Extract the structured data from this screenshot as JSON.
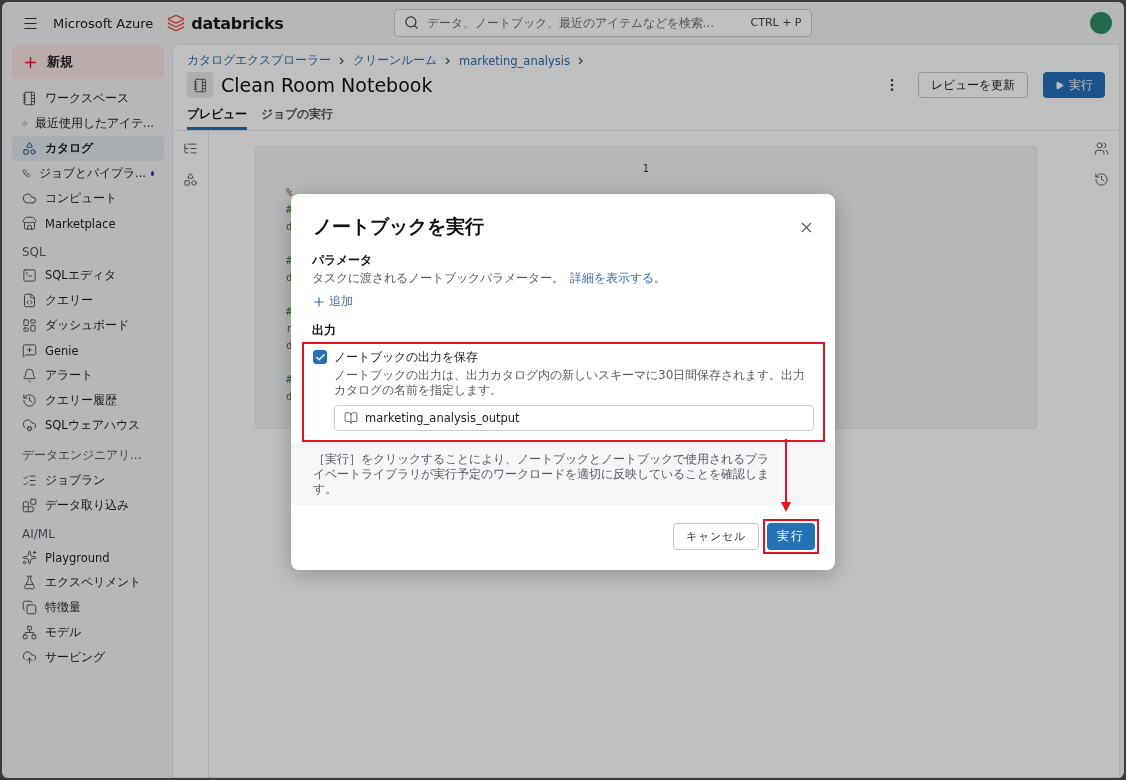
{
  "topbar": {
    "brand": "Microsoft Azure",
    "product": "databricks",
    "search": {
      "placeholder": "データ、ノートブック、最近のアイテムなどを検索...",
      "shortcut": "CTRL + P"
    }
  },
  "sidebar": {
    "new_button": "新規",
    "sections": [
      {
        "items": [
          {
            "label": "ワークスペース",
            "selected": false,
            "dot": false
          },
          {
            "label": "最近使用したアイテ...",
            "selected": false,
            "dot": false
          },
          {
            "label": "カタログ",
            "selected": true,
            "dot": false
          },
          {
            "label": "ジョブとパイプラ...",
            "selected": false,
            "dot": true
          },
          {
            "label": "コンピュート",
            "selected": false,
            "dot": false
          },
          {
            "label": "Marketplace",
            "selected": false,
            "dot": false
          }
        ]
      },
      {
        "heading": "SQL",
        "items": [
          {
            "label": "SQLエディタ",
            "selected": false,
            "dot": false
          },
          {
            "label": "クエリー",
            "selected": false,
            "dot": false
          },
          {
            "label": "ダッシュボード",
            "selected": false,
            "dot": false
          },
          {
            "label": "Genie",
            "selected": false,
            "dot": false
          },
          {
            "label": "アラート",
            "selected": false,
            "dot": false
          },
          {
            "label": "クエリー履歴",
            "selected": false,
            "dot": false
          },
          {
            "label": "SQLウェアハウス",
            "selected": false,
            "dot": false
          }
        ]
      },
      {
        "heading": "データエンジニアリ...",
        "items": [
          {
            "label": "ジョブラン",
            "selected": false,
            "dot": false
          },
          {
            "label": "データ取り込み",
            "selected": false,
            "dot": false
          }
        ]
      },
      {
        "heading": "AI/ML",
        "items": [
          {
            "label": "Playground",
            "selected": false,
            "dot": false
          },
          {
            "label": "エクスペリメント",
            "selected": false,
            "dot": false
          },
          {
            "label": "特徴量",
            "selected": false,
            "dot": false
          },
          {
            "label": "モデル",
            "selected": false,
            "dot": false
          },
          {
            "label": "サービング",
            "selected": false,
            "dot": false
          }
        ]
      }
    ]
  },
  "page": {
    "breadcrumb": [
      "カタログエクスプローラー",
      "クリーンルーム",
      "marketing_analysis"
    ],
    "title": "Clean Room Notebook",
    "review_button": "レビューを更新",
    "run_button": "実行",
    "tabs": [
      {
        "label": "プレビュー",
        "selected": true
      },
      {
        "label": "ジョブの実行",
        "selected": false
      }
    ],
    "notebook": {
      "cell_number": "1",
      "lines": [
        {
          "text": "%",
          "kind": "code"
        },
        {
          "text": "#",
          "kind": "comment"
        },
        {
          "text": "d",
          "kind": "code"
        },
        {
          "kind": "blank"
        },
        {
          "text": "#",
          "kind": "comment"
        },
        {
          "text": "d",
          "kind": "code"
        },
        {
          "kind": "blank"
        },
        {
          "text": "#",
          "kind": "comment"
        },
        {
          "text": "r",
          "kind": "code"
        },
        {
          "text": "d",
          "kind": "code"
        },
        {
          "kind": "blank"
        },
        {
          "text": "#",
          "kind": "comment"
        },
        {
          "text": "d",
          "kind": "code"
        }
      ]
    }
  },
  "dialog": {
    "title": "ノートブックを実行",
    "parameters": {
      "heading": "パラメータ",
      "description": "タスクに渡されるノートブックパラメーター。",
      "link": "詳細を表示する。",
      "add": "追加"
    },
    "output": {
      "heading": "出力",
      "checkbox": {
        "label": "ノートブックの出力を保存",
        "checked": true
      },
      "description": "ノートブックの出力は、出力カタログ内の新しいスキーマに30日間保存されます。出力カタログの名前を指定します。",
      "catalog_value": "marketing_analysis_output"
    },
    "notice": "［実行］をクリックすることにより、ノートブックとノートブックで使用されるプライベートライブラリが実行予定のワークロードを適切に反映していることを確認します。",
    "cancel": "キャンセル",
    "confirm": "実行"
  }
}
